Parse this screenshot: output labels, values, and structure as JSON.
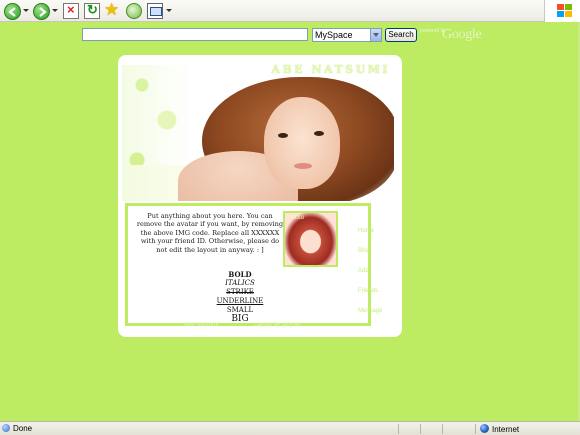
{
  "browser": {
    "toolbar": {
      "back": "back-arrow-icon",
      "forward": "forward-arrow-icon",
      "stop": "stop-icon",
      "refresh": "refresh-icon",
      "favorites": "star-icon",
      "history": "history-icon",
      "mail": "mail-icon"
    },
    "status": {
      "text": "Done",
      "zone": "Internet"
    }
  },
  "search": {
    "value": "",
    "engine_selected": "MySpace",
    "button_label": "Search",
    "powered_by": "powered by",
    "brand": "Google"
  },
  "profile": {
    "title": "ABE NATSUMI",
    "about": "Put anything about you here. You can remove the avatar if you want, by removing the above IMG code. Replace all XXXXXX with your friend ID. Otherwise, please do not edit the layout in anyway. : ]",
    "avatar_tag": "Natsu",
    "styles": {
      "bold": "BOLD",
      "italics": "ITALICS",
      "strike": "STRIKE",
      "underline": "UNDERLINE",
      "small": "SMALL",
      "big": "BIG"
    },
    "right_links": [
      "Home",
      "Blog",
      "Add",
      "Friends",
      "Message"
    ],
    "bottom_links": [
      "Abe Natsumi",
      "Layout by girlynet"
    ]
  },
  "colors": {
    "page_background": "#bdeb62",
    "card": "#ffffff",
    "accent": "#bdeb62"
  }
}
